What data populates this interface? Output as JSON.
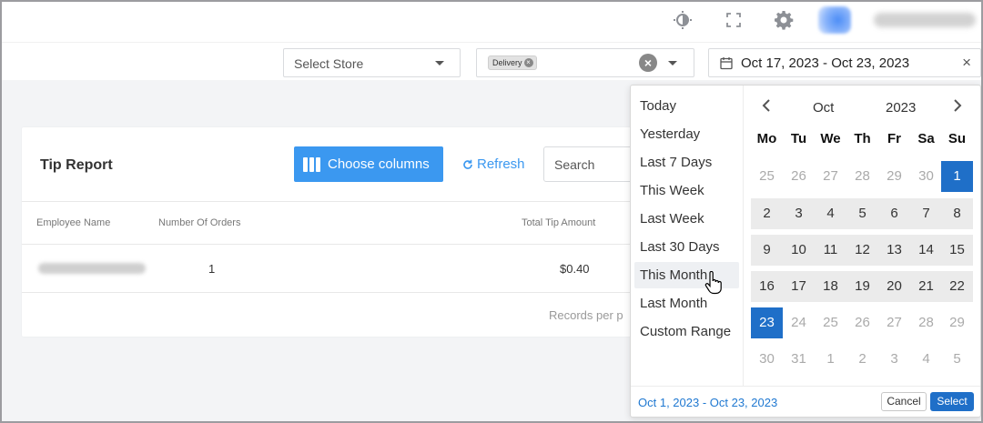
{
  "header": {
    "icons": [
      "theme-contrast-icon",
      "fullscreen-icon",
      "settings-gear-icon"
    ]
  },
  "filters": {
    "store_placeholder": "Select Store",
    "order_type_chip": "Delivery",
    "date_range_value": "Oct 17, 2023 - Oct 23, 2023"
  },
  "report": {
    "title": "Tip Report",
    "choose_columns_label": "Choose columns",
    "refresh_label": "Refresh",
    "search_placeholder": "Search",
    "columns": [
      "Employee Name",
      "Number Of Orders",
      "Total Tip Amount"
    ],
    "rows": [
      {
        "employee": "chirag.kubavat",
        "orders": "1",
        "tip_amount": "$0.40"
      }
    ],
    "footer_text": "Records per p"
  },
  "datepicker": {
    "ranges": [
      "Today",
      "Yesterday",
      "Last 7 Days",
      "This Week",
      "Last Week",
      "Last 30 Days",
      "This Month",
      "Last Month",
      "Custom Range"
    ],
    "hovered_range": "This Month",
    "month": "Oct",
    "year": "2023",
    "weekdays": [
      "Mo",
      "Tu",
      "We",
      "Th",
      "Fr",
      "Sa",
      "Su"
    ],
    "weeks": [
      [
        "25",
        "26",
        "27",
        "28",
        "29",
        "30",
        "1"
      ],
      [
        "2",
        "3",
        "4",
        "5",
        "6",
        "7",
        "8"
      ],
      [
        "9",
        "10",
        "11",
        "12",
        "13",
        "14",
        "15"
      ],
      [
        "16",
        "17",
        "18",
        "19",
        "20",
        "21",
        "22"
      ],
      [
        "23",
        "24",
        "25",
        "26",
        "27",
        "28",
        "29"
      ],
      [
        "30",
        "31",
        "1",
        "2",
        "3",
        "4",
        "5"
      ]
    ],
    "selected_range_label": "Oct 1, 2023 - Oct 23, 2023",
    "cancel_label": "Cancel",
    "select_label": "Select",
    "accent_color": "#1f6fc8"
  }
}
